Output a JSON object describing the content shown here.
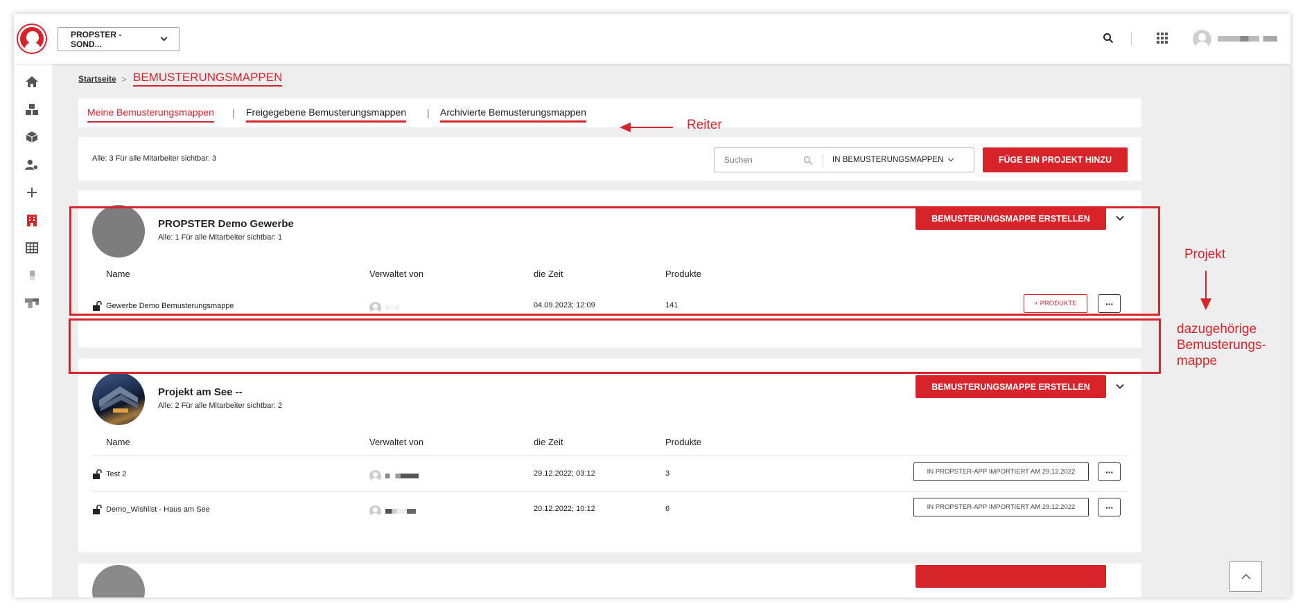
{
  "header": {
    "project_selector": "PROPSTER - SOND...",
    "icons": [
      "search-icon",
      "apps-grid-icon",
      "user-avatar-icon"
    ]
  },
  "sidebar": {
    "icons": [
      "home-icon",
      "boxes-icon",
      "cube-icon",
      "user-settings-icon",
      "plus-icon",
      "building-icon",
      "table-icon",
      "small-block-icon",
      "blocks-icon"
    ],
    "active": "building-icon"
  },
  "breadcrumb": {
    "home": "Startseite",
    "separator": ">",
    "current": "BEMUSTERUNGSMAPPEN"
  },
  "tabs": [
    {
      "label": "Meine Bemusterungsmappen",
      "active": true
    },
    {
      "label": "Freigegebene Bemusterungsmappen",
      "active": false
    },
    {
      "label": "Archivierte Bemusterungsmappen",
      "active": false
    }
  ],
  "tab_separator": "|",
  "filterbar": {
    "count": "Alle: 3 Für alle Mitarbeiter sichtbar: 3",
    "search_placeholder": "Suchen",
    "filter_label": "IN BEMUSTERUNGSMAPPEN",
    "add_project_label": "FÜGE EIN PROJEKT HINZU"
  },
  "columns": [
    "Name",
    "Verwaltet von",
    "die Zeit",
    "Produkte"
  ],
  "projects": [
    {
      "title": "PROPSTER Demo Gewerbe",
      "subtitle": "Alle: 1 Für alle Mitarbeiter sichtbar: 1",
      "create_label": "BEMUSTERUNGSMAPPE ERSTELLEN",
      "rows": [
        {
          "name": "Gewerbe Demo Bemusterungsmappe",
          "time": "04.09.2023; 12:09",
          "products": "141",
          "action": "+ PRODUKTE"
        }
      ]
    },
    {
      "title": "Projekt am See --",
      "subtitle": "Alle: 2 Für alle Mitarbeiter sichtbar: 2",
      "create_label": "BEMUSTERUNGSMAPPE ERSTELLEN",
      "rows": [
        {
          "name": "Test 2",
          "time": "29.12.2022; 03:12",
          "products": "3",
          "action": "IN PROPSTER-APP IMPORTIERT AM 29.12.2022"
        },
        {
          "name": "Demo_Wishlist - Haus am See",
          "time": "20.12.2022; 10:12",
          "products": "6",
          "action": "IN PROPSTER-APP IMPORTIERT AM 29.12.2022"
        }
      ]
    }
  ],
  "more_label": "···",
  "annotations": {
    "tabs": "Reiter",
    "project": "Projekt",
    "folder_line1": "dazugehörige",
    "folder_line2": "Bemusterungs-",
    "folder_line3": "mappe"
  },
  "colors": {
    "accent": "#d8232a",
    "background": "#eeeeee"
  }
}
